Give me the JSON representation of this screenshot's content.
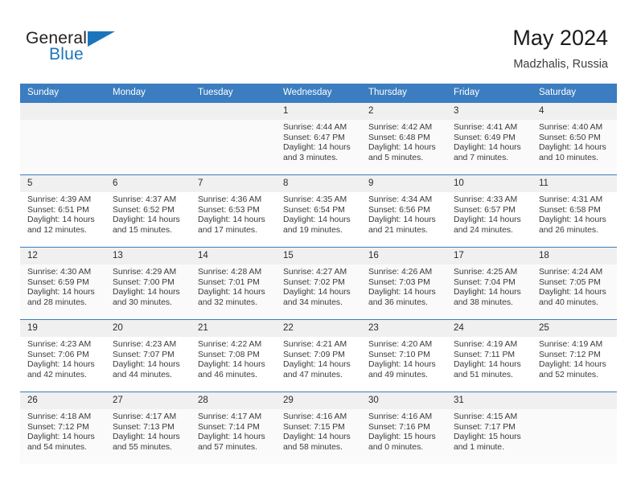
{
  "logo": {
    "word_top": "General",
    "word_bottom": "Blue",
    "triangle_color": "#1c75bc"
  },
  "header": {
    "title": "May 2024",
    "subtitle": "Madzhalis, Russia"
  },
  "colors": {
    "header_blue": "#3b7dc0",
    "daynum_band": "#f0f0f0",
    "row_shade": "#fafafa"
  },
  "weekday_headers": [
    "Sunday",
    "Monday",
    "Tuesday",
    "Wednesday",
    "Thursday",
    "Friday",
    "Saturday"
  ],
  "weeks": [
    [
      {
        "day": "",
        "empty": true,
        "sunrise": "",
        "sunset": "",
        "daylight_line1": "",
        "daylight_line2": ""
      },
      {
        "day": "",
        "empty": true,
        "sunrise": "",
        "sunset": "",
        "daylight_line1": "",
        "daylight_line2": ""
      },
      {
        "day": "",
        "empty": true,
        "sunrise": "",
        "sunset": "",
        "daylight_line1": "",
        "daylight_line2": ""
      },
      {
        "day": "1",
        "empty": false,
        "sunrise": "Sunrise: 4:44 AM",
        "sunset": "Sunset: 6:47 PM",
        "daylight_line1": "Daylight: 14 hours",
        "daylight_line2": "and 3 minutes."
      },
      {
        "day": "2",
        "empty": false,
        "sunrise": "Sunrise: 4:42 AM",
        "sunset": "Sunset: 6:48 PM",
        "daylight_line1": "Daylight: 14 hours",
        "daylight_line2": "and 5 minutes."
      },
      {
        "day": "3",
        "empty": false,
        "sunrise": "Sunrise: 4:41 AM",
        "sunset": "Sunset: 6:49 PM",
        "daylight_line1": "Daylight: 14 hours",
        "daylight_line2": "and 7 minutes."
      },
      {
        "day": "4",
        "empty": false,
        "sunrise": "Sunrise: 4:40 AM",
        "sunset": "Sunset: 6:50 PM",
        "daylight_line1": "Daylight: 14 hours",
        "daylight_line2": "and 10 minutes."
      }
    ],
    [
      {
        "day": "5",
        "empty": false,
        "sunrise": "Sunrise: 4:39 AM",
        "sunset": "Sunset: 6:51 PM",
        "daylight_line1": "Daylight: 14 hours",
        "daylight_line2": "and 12 minutes."
      },
      {
        "day": "6",
        "empty": false,
        "sunrise": "Sunrise: 4:37 AM",
        "sunset": "Sunset: 6:52 PM",
        "daylight_line1": "Daylight: 14 hours",
        "daylight_line2": "and 15 minutes."
      },
      {
        "day": "7",
        "empty": false,
        "sunrise": "Sunrise: 4:36 AM",
        "sunset": "Sunset: 6:53 PM",
        "daylight_line1": "Daylight: 14 hours",
        "daylight_line2": "and 17 minutes."
      },
      {
        "day": "8",
        "empty": false,
        "sunrise": "Sunrise: 4:35 AM",
        "sunset": "Sunset: 6:54 PM",
        "daylight_line1": "Daylight: 14 hours",
        "daylight_line2": "and 19 minutes."
      },
      {
        "day": "9",
        "empty": false,
        "sunrise": "Sunrise: 4:34 AM",
        "sunset": "Sunset: 6:56 PM",
        "daylight_line1": "Daylight: 14 hours",
        "daylight_line2": "and 21 minutes."
      },
      {
        "day": "10",
        "empty": false,
        "sunrise": "Sunrise: 4:33 AM",
        "sunset": "Sunset: 6:57 PM",
        "daylight_line1": "Daylight: 14 hours",
        "daylight_line2": "and 24 minutes."
      },
      {
        "day": "11",
        "empty": false,
        "sunrise": "Sunrise: 4:31 AM",
        "sunset": "Sunset: 6:58 PM",
        "daylight_line1": "Daylight: 14 hours",
        "daylight_line2": "and 26 minutes."
      }
    ],
    [
      {
        "day": "12",
        "empty": false,
        "sunrise": "Sunrise: 4:30 AM",
        "sunset": "Sunset: 6:59 PM",
        "daylight_line1": "Daylight: 14 hours",
        "daylight_line2": "and 28 minutes."
      },
      {
        "day": "13",
        "empty": false,
        "sunrise": "Sunrise: 4:29 AM",
        "sunset": "Sunset: 7:00 PM",
        "daylight_line1": "Daylight: 14 hours",
        "daylight_line2": "and 30 minutes."
      },
      {
        "day": "14",
        "empty": false,
        "sunrise": "Sunrise: 4:28 AM",
        "sunset": "Sunset: 7:01 PM",
        "daylight_line1": "Daylight: 14 hours",
        "daylight_line2": "and 32 minutes."
      },
      {
        "day": "15",
        "empty": false,
        "sunrise": "Sunrise: 4:27 AM",
        "sunset": "Sunset: 7:02 PM",
        "daylight_line1": "Daylight: 14 hours",
        "daylight_line2": "and 34 minutes."
      },
      {
        "day": "16",
        "empty": false,
        "sunrise": "Sunrise: 4:26 AM",
        "sunset": "Sunset: 7:03 PM",
        "daylight_line1": "Daylight: 14 hours",
        "daylight_line2": "and 36 minutes."
      },
      {
        "day": "17",
        "empty": false,
        "sunrise": "Sunrise: 4:25 AM",
        "sunset": "Sunset: 7:04 PM",
        "daylight_line1": "Daylight: 14 hours",
        "daylight_line2": "and 38 minutes."
      },
      {
        "day": "18",
        "empty": false,
        "sunrise": "Sunrise: 4:24 AM",
        "sunset": "Sunset: 7:05 PM",
        "daylight_line1": "Daylight: 14 hours",
        "daylight_line2": "and 40 minutes."
      }
    ],
    [
      {
        "day": "19",
        "empty": false,
        "sunrise": "Sunrise: 4:23 AM",
        "sunset": "Sunset: 7:06 PM",
        "daylight_line1": "Daylight: 14 hours",
        "daylight_line2": "and 42 minutes."
      },
      {
        "day": "20",
        "empty": false,
        "sunrise": "Sunrise: 4:23 AM",
        "sunset": "Sunset: 7:07 PM",
        "daylight_line1": "Daylight: 14 hours",
        "daylight_line2": "and 44 minutes."
      },
      {
        "day": "21",
        "empty": false,
        "sunrise": "Sunrise: 4:22 AM",
        "sunset": "Sunset: 7:08 PM",
        "daylight_line1": "Daylight: 14 hours",
        "daylight_line2": "and 46 minutes."
      },
      {
        "day": "22",
        "empty": false,
        "sunrise": "Sunrise: 4:21 AM",
        "sunset": "Sunset: 7:09 PM",
        "daylight_line1": "Daylight: 14 hours",
        "daylight_line2": "and 47 minutes."
      },
      {
        "day": "23",
        "empty": false,
        "sunrise": "Sunrise: 4:20 AM",
        "sunset": "Sunset: 7:10 PM",
        "daylight_line1": "Daylight: 14 hours",
        "daylight_line2": "and 49 minutes."
      },
      {
        "day": "24",
        "empty": false,
        "sunrise": "Sunrise: 4:19 AM",
        "sunset": "Sunset: 7:11 PM",
        "daylight_line1": "Daylight: 14 hours",
        "daylight_line2": "and 51 minutes."
      },
      {
        "day": "25",
        "empty": false,
        "sunrise": "Sunrise: 4:19 AM",
        "sunset": "Sunset: 7:12 PM",
        "daylight_line1": "Daylight: 14 hours",
        "daylight_line2": "and 52 minutes."
      }
    ],
    [
      {
        "day": "26",
        "empty": false,
        "sunrise": "Sunrise: 4:18 AM",
        "sunset": "Sunset: 7:12 PM",
        "daylight_line1": "Daylight: 14 hours",
        "daylight_line2": "and 54 minutes."
      },
      {
        "day": "27",
        "empty": false,
        "sunrise": "Sunrise: 4:17 AM",
        "sunset": "Sunset: 7:13 PM",
        "daylight_line1": "Daylight: 14 hours",
        "daylight_line2": "and 55 minutes."
      },
      {
        "day": "28",
        "empty": false,
        "sunrise": "Sunrise: 4:17 AM",
        "sunset": "Sunset: 7:14 PM",
        "daylight_line1": "Daylight: 14 hours",
        "daylight_line2": "and 57 minutes."
      },
      {
        "day": "29",
        "empty": false,
        "sunrise": "Sunrise: 4:16 AM",
        "sunset": "Sunset: 7:15 PM",
        "daylight_line1": "Daylight: 14 hours",
        "daylight_line2": "and 58 minutes."
      },
      {
        "day": "30",
        "empty": false,
        "sunrise": "Sunrise: 4:16 AM",
        "sunset": "Sunset: 7:16 PM",
        "daylight_line1": "Daylight: 15 hours",
        "daylight_line2": "and 0 minutes."
      },
      {
        "day": "31",
        "empty": false,
        "sunrise": "Sunrise: 4:15 AM",
        "sunset": "Sunset: 7:17 PM",
        "daylight_line1": "Daylight: 15 hours",
        "daylight_line2": "and 1 minute."
      },
      {
        "day": "",
        "empty": true,
        "sunrise": "",
        "sunset": "",
        "daylight_line1": "",
        "daylight_line2": ""
      }
    ]
  ]
}
